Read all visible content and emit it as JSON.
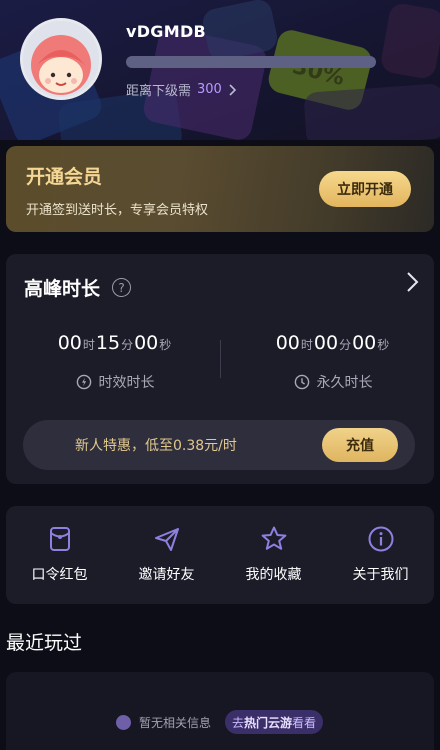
{
  "profile": {
    "username": "vDGMDB",
    "level_progress": 0.0,
    "next_level_label": "距离下级需",
    "next_level_value": "300",
    "header_deco_text": "30%"
  },
  "vip": {
    "title": "开通会员",
    "subtitle": "开通签到送时长，专享会员特权",
    "button": "立即开通"
  },
  "peak": {
    "title": "高峰时长",
    "timed": {
      "h": "00",
      "m": "15",
      "s": "00",
      "label": "时效时长"
    },
    "permanent": {
      "h": "00",
      "m": "00",
      "s": "00",
      "label": "永久时长"
    },
    "units": {
      "h": "时",
      "m": "分",
      "s": "秒"
    },
    "promo_text": "新人特惠，低至0.38元/时",
    "promo_button": "充值"
  },
  "actions": [
    {
      "label": "口令红包",
      "icon": "red-packet-icon"
    },
    {
      "label": "邀请好友",
      "icon": "paper-plane-icon"
    },
    {
      "label": "我的收藏",
      "icon": "star-icon"
    },
    {
      "label": "关于我们",
      "icon": "info-icon"
    }
  ],
  "recent": {
    "title": "最近玩过",
    "empty_text": "暂无相关信息",
    "go_hot_prefix": "去",
    "go_hot_bold": "热门云游",
    "go_hot_suffix": "看看"
  },
  "colors": {
    "accent_purple": "#b79bff",
    "gold": "#f5d695",
    "card_bg": "#1c1c29",
    "page_bg": "#0d0d17",
    "icon_purple": "#8f7fe0"
  }
}
